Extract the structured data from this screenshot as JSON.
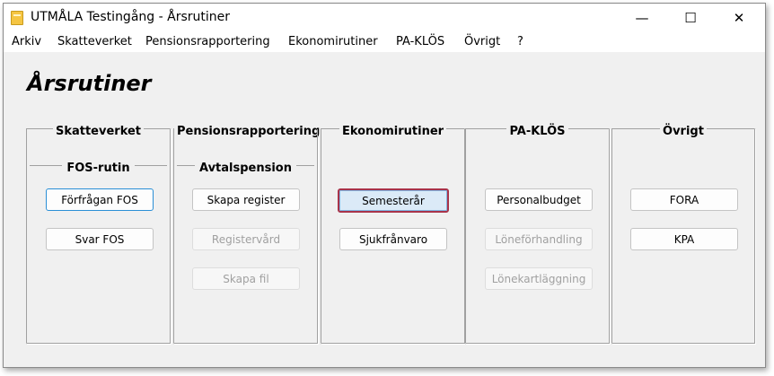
{
  "window": {
    "title": "UTMÅLA Testingång - Årsrutiner",
    "minimize": "—",
    "maximize": "☐",
    "close": "✕"
  },
  "menu": [
    "Arkiv",
    "Skatteverket",
    "Pensionsrapportering",
    "Ekonomirutiner",
    "PA-KLÖS",
    "Övrigt",
    "?"
  ],
  "heading": "Årsrutiner",
  "groups": {
    "skatteverket": {
      "title": "Skatteverket",
      "subtitle": "FOS-rutin",
      "buttons": [
        "Förfrågan FOS",
        "Svar FOS"
      ]
    },
    "pension": {
      "title": "Pensionsrapportering",
      "subtitle": "Avtalspension",
      "buttons": [
        "Skapa register",
        "Registervård",
        "Skapa fil"
      ]
    },
    "ekonomi": {
      "title": "Ekonomirutiner",
      "buttons": [
        "Semesterår",
        "Sjukfrånvaro"
      ]
    },
    "paklos": {
      "title": "PA-KLÖS",
      "buttons": [
        "Personalbudget",
        "Löneförhandling",
        "Lönekartläggning"
      ]
    },
    "ovrigt": {
      "title": "Övrigt",
      "buttons": [
        "FORA",
        "KPA"
      ]
    }
  }
}
